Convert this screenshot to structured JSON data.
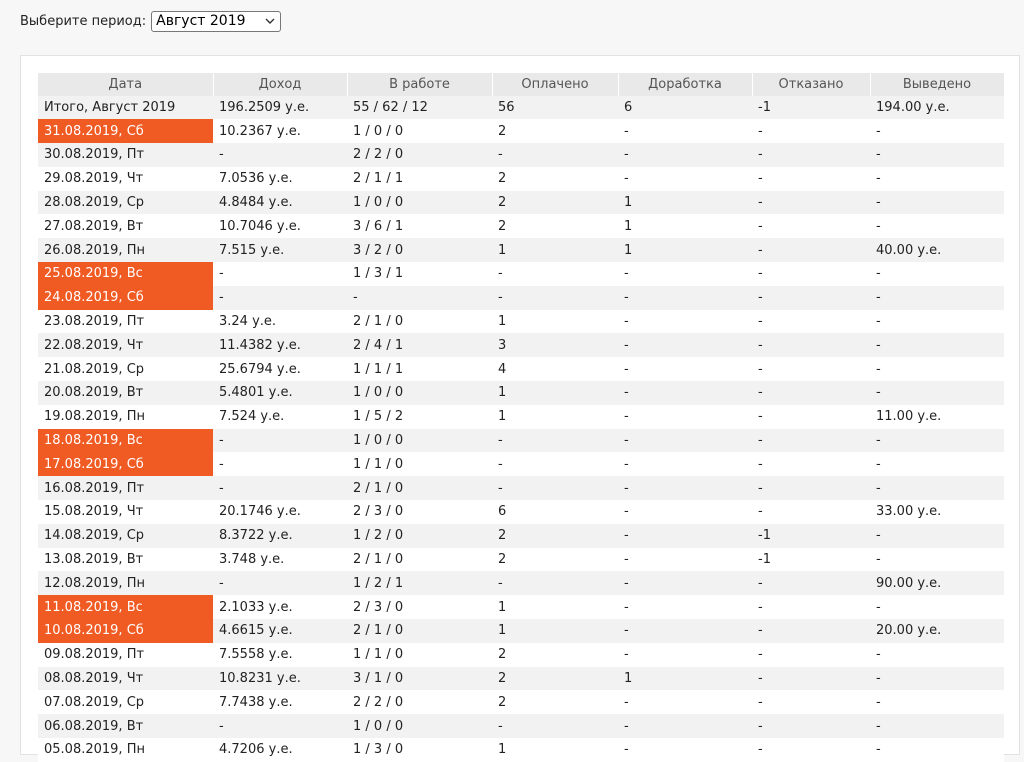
{
  "period": {
    "label": "Выберите период:",
    "selected": "Август 2019"
  },
  "table": {
    "headers": [
      "Дата",
      "Доход",
      "В работе",
      "Оплачено",
      "Доработка",
      "Отказано",
      "Выведено"
    ],
    "rows": [
      {
        "date": "Итого, Август 2019",
        "income": "196.2509 у.е.",
        "work": "55 / 62 / 12",
        "paid": "56",
        "rework": "6",
        "refused": "-1",
        "withdrawn": "194.00 у.е.",
        "weekend": false
      },
      {
        "date": "31.08.2019, Сб",
        "income": "10.2367 у.е.",
        "work": "1 / 0 / 0",
        "paid": "2",
        "rework": "-",
        "refused": "-",
        "withdrawn": "-",
        "weekend": true
      },
      {
        "date": "30.08.2019, Пт",
        "income": "-",
        "work": "2 / 2 / 0",
        "paid": "-",
        "rework": "-",
        "refused": "-",
        "withdrawn": "-",
        "weekend": false
      },
      {
        "date": "29.08.2019, Чт",
        "income": "7.0536 у.е.",
        "work": "2 / 1 / 1",
        "paid": "2",
        "rework": "-",
        "refused": "-",
        "withdrawn": "-",
        "weekend": false
      },
      {
        "date": "28.08.2019, Ср",
        "income": "4.8484 у.е.",
        "work": "1 / 0 / 0",
        "paid": "2",
        "rework": "1",
        "refused": "-",
        "withdrawn": "-",
        "weekend": false
      },
      {
        "date": "27.08.2019, Вт",
        "income": "10.7046 у.е.",
        "work": "3 / 6 / 1",
        "paid": "2",
        "rework": "1",
        "refused": "-",
        "withdrawn": "-",
        "weekend": false
      },
      {
        "date": "26.08.2019, Пн",
        "income": "7.515 у.е.",
        "work": "3 / 2 / 0",
        "paid": "1",
        "rework": "1",
        "refused": "-",
        "withdrawn": "40.00 у.е.",
        "weekend": false
      },
      {
        "date": "25.08.2019, Вс",
        "income": "-",
        "work": "1 / 3 / 1",
        "paid": "-",
        "rework": "-",
        "refused": "-",
        "withdrawn": "-",
        "weekend": true
      },
      {
        "date": "24.08.2019, Сб",
        "income": "-",
        "work": "-",
        "paid": "-",
        "rework": "-",
        "refused": "-",
        "withdrawn": "-",
        "weekend": true
      },
      {
        "date": "23.08.2019, Пт",
        "income": "3.24 у.е.",
        "work": "2 / 1 / 0",
        "paid": "1",
        "rework": "-",
        "refused": "-",
        "withdrawn": "-",
        "weekend": false
      },
      {
        "date": "22.08.2019, Чт",
        "income": "11.4382 у.е.",
        "work": "2 / 4 / 1",
        "paid": "3",
        "rework": "-",
        "refused": "-",
        "withdrawn": "-",
        "weekend": false
      },
      {
        "date": "21.08.2019, Ср",
        "income": "25.6794 у.е.",
        "work": "1 / 1 / 1",
        "paid": "4",
        "rework": "-",
        "refused": "-",
        "withdrawn": "-",
        "weekend": false
      },
      {
        "date": "20.08.2019, Вт",
        "income": "5.4801 у.е.",
        "work": "1 / 0 / 0",
        "paid": "1",
        "rework": "-",
        "refused": "-",
        "withdrawn": "-",
        "weekend": false
      },
      {
        "date": "19.08.2019, Пн",
        "income": "7.524 у.е.",
        "work": "1 / 5 / 2",
        "paid": "1",
        "rework": "-",
        "refused": "-",
        "withdrawn": "11.00 у.е.",
        "weekend": false
      },
      {
        "date": "18.08.2019, Вс",
        "income": "-",
        "work": "1 / 0 / 0",
        "paid": "-",
        "rework": "-",
        "refused": "-",
        "withdrawn": "-",
        "weekend": true
      },
      {
        "date": "17.08.2019, Сб",
        "income": "-",
        "work": "1 / 1 / 0",
        "paid": "-",
        "rework": "-",
        "refused": "-",
        "withdrawn": "-",
        "weekend": true
      },
      {
        "date": "16.08.2019, Пт",
        "income": "-",
        "work": "2 / 1 / 0",
        "paid": "-",
        "rework": "-",
        "refused": "-",
        "withdrawn": "-",
        "weekend": false
      },
      {
        "date": "15.08.2019, Чт",
        "income": "20.1746 у.е.",
        "work": "2 / 3 / 0",
        "paid": "6",
        "rework": "-",
        "refused": "-",
        "withdrawn": "33.00 у.е.",
        "weekend": false
      },
      {
        "date": "14.08.2019, Ср",
        "income": "8.3722 у.е.",
        "work": "1 / 2 / 0",
        "paid": "2",
        "rework": "-",
        "refused": "-1",
        "withdrawn": "-",
        "weekend": false
      },
      {
        "date": "13.08.2019, Вт",
        "income": "3.748 у.е.",
        "work": "2 / 1 / 0",
        "paid": "2",
        "rework": "-",
        "refused": "-1",
        "withdrawn": "-",
        "weekend": false
      },
      {
        "date": "12.08.2019, Пн",
        "income": "-",
        "work": "1 / 2 / 1",
        "paid": "-",
        "rework": "-",
        "refused": "-",
        "withdrawn": "90.00 у.е.",
        "weekend": false
      },
      {
        "date": "11.08.2019, Вс",
        "income": "2.1033 у.е.",
        "work": "2 / 3 / 0",
        "paid": "1",
        "rework": "-",
        "refused": "-",
        "withdrawn": "-",
        "weekend": true
      },
      {
        "date": "10.08.2019, Сб",
        "income": "4.6615 у.е.",
        "work": "2 / 1 / 0",
        "paid": "1",
        "rework": "-",
        "refused": "-",
        "withdrawn": "20.00 у.е.",
        "weekend": true
      },
      {
        "date": "09.08.2019, Пт",
        "income": "7.5558 у.е.",
        "work": "1 / 1 / 0",
        "paid": "2",
        "rework": "-",
        "refused": "-",
        "withdrawn": "-",
        "weekend": false
      },
      {
        "date": "08.08.2019, Чт",
        "income": "10.8231 у.е.",
        "work": "3 / 1 / 0",
        "paid": "2",
        "rework": "1",
        "refused": "-",
        "withdrawn": "-",
        "weekend": false
      },
      {
        "date": "07.08.2019, Ср",
        "income": "7.7438 у.е.",
        "work": "2 / 2 / 0",
        "paid": "2",
        "rework": "-",
        "refused": "-",
        "withdrawn": "-",
        "weekend": false
      },
      {
        "date": "06.08.2019, Вт",
        "income": "-",
        "work": "1 / 0 / 0",
        "paid": "-",
        "rework": "-",
        "refused": "-",
        "withdrawn": "-",
        "weekend": false
      },
      {
        "date": "05.08.2019, Пн",
        "income": "4.7206 у.е.",
        "work": "1 / 3 / 0",
        "paid": "1",
        "rework": "-",
        "refused": "-",
        "withdrawn": "-",
        "weekend": false
      }
    ]
  },
  "colors": {
    "weekend": "#f05a23",
    "header_bg": "#e9e9e9",
    "stripe": "#f2f2f2"
  }
}
